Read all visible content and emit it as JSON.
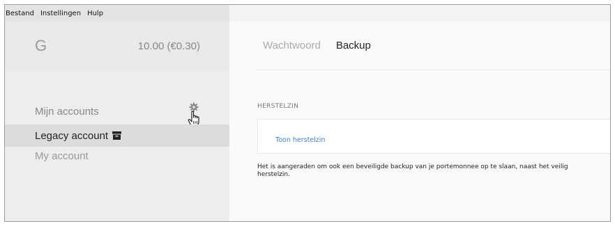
{
  "menu": {
    "items": [
      "Bestand",
      "Instellingen",
      "Hulp"
    ]
  },
  "sidebar": {
    "logo": "G",
    "balance": "10.00 (€0.30)",
    "section_title": "Mijn accounts",
    "accounts": [
      {
        "label": "Legacy account",
        "active": true,
        "icon": "archive-icon"
      },
      {
        "label": "My account",
        "active": false
      }
    ],
    "settings_icon": "gear-icon"
  },
  "main": {
    "tabs": [
      {
        "label": "Wachtwoord",
        "active": false
      },
      {
        "label": "Backup",
        "active": true
      }
    ],
    "section_label": "HERSTELZIN",
    "card_link": "Toon herstelzin",
    "description_line1": "Het is aangeraden om ook een beveiligde backup van je portemonnee op te slaan, naast het veilig",
    "description_line2": "herstelzin."
  },
  "colors": {
    "link": "#3b7fc4",
    "sidebar_bg": "#ededed",
    "active_item_bg": "#dcdcdc"
  }
}
